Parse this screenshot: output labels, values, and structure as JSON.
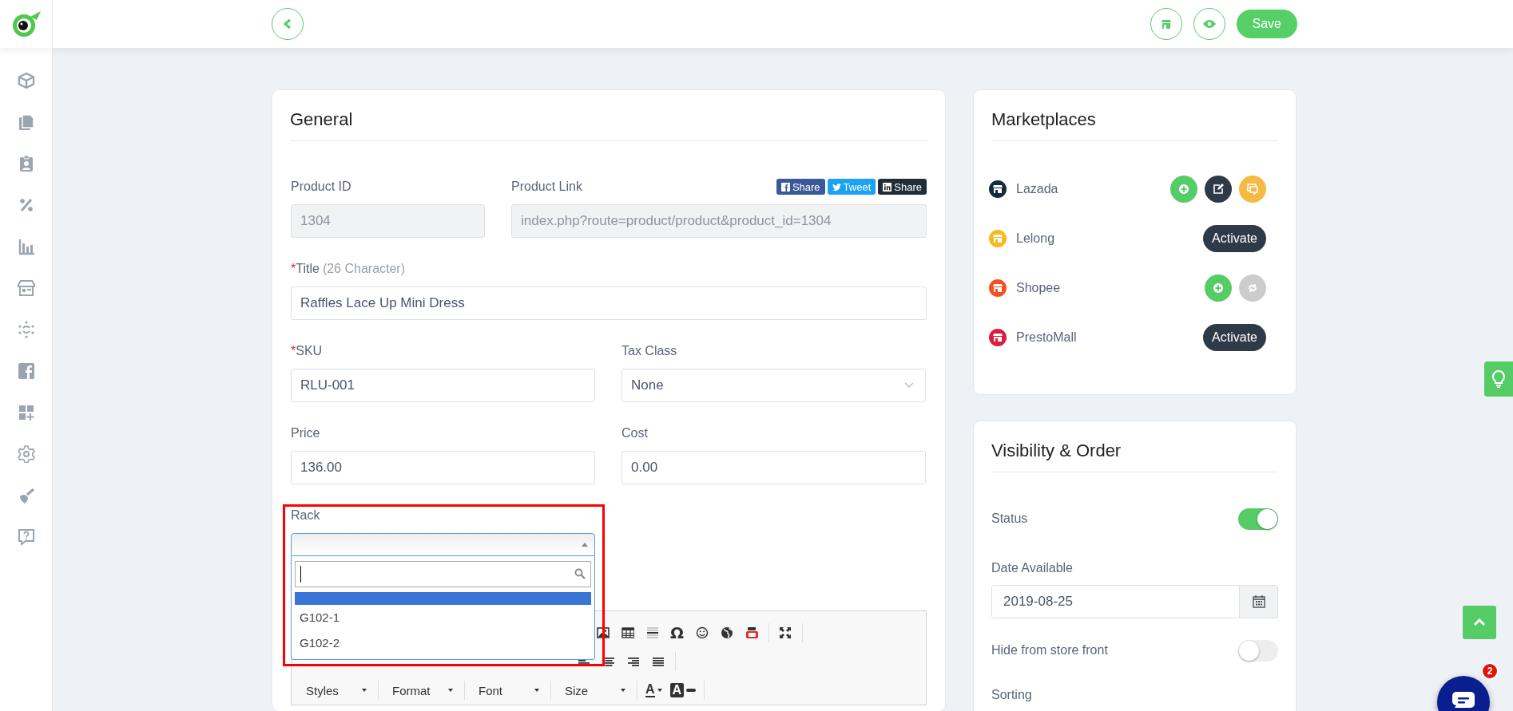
{
  "top_bar": {
    "save_button": "Save"
  },
  "general": {
    "title": "General",
    "product_id": {
      "label": "Product ID",
      "value": "1304",
      "disabled": true
    },
    "product_link": {
      "label": "Product Link",
      "value": "index.php?route=product/product&product_id=1304",
      "disabled": true
    },
    "share_buttons": [
      {
        "kind": "facebook",
        "label": "Share"
      },
      {
        "kind": "twitter",
        "label": "Tweet"
      },
      {
        "kind": "linkedin",
        "label": "Share"
      }
    ],
    "title_field": {
      "required_mark": "*",
      "label": "Title",
      "hint": "(26 Character)",
      "value": "Raffles Lace Up Mini Dress"
    },
    "sku": {
      "required_mark": "*",
      "label": "SKU",
      "value": "RLU-001"
    },
    "tax_class": {
      "label": "Tax Class",
      "value": "None"
    },
    "price": {
      "label": "Price",
      "value": "136.00"
    },
    "cost": {
      "label": "Cost",
      "value": "0.00"
    },
    "rack": {
      "label": "Rack",
      "highlighted": true,
      "expanded": true,
      "options": [
        {
          "kind": "blank",
          "selected": true
        },
        {
          "label": "G102-1",
          "selected": false
        },
        {
          "label": "G102-2",
          "selected": false
        }
      ]
    },
    "editor": {
      "symbol_button": "Ω",
      "dropdowns": [
        "Styles",
        "Format",
        "Font",
        "Size"
      ],
      "color_buttons": [
        {
          "kind": "text",
          "label": "A"
        },
        {
          "kind": "background",
          "label": "A"
        }
      ]
    }
  },
  "marketplaces": {
    "title": "Marketplaces",
    "items": [
      {
        "name": "Lazada",
        "color": "#142a3e",
        "activated": true,
        "actions": [
          {
            "kind": "add",
            "disabled": false
          },
          {
            "kind": "edit",
            "disabled": false
          },
          {
            "kind": "messages",
            "disabled": false
          }
        ]
      },
      {
        "name": "Lelong",
        "color": "#f9b81b",
        "activated": false,
        "activate_button": "Activate"
      },
      {
        "name": "Shopee",
        "color": "#f4511e",
        "activated": true,
        "actions": [
          {
            "kind": "add",
            "disabled": false
          },
          {
            "kind": "sync",
            "disabled": true
          }
        ]
      },
      {
        "name": "PrestoMall",
        "color": "#dc1c3a",
        "activated": false,
        "activate_button": "Activate"
      }
    ]
  },
  "visibility": {
    "title": "Visibility & Order",
    "status": {
      "label": "Status",
      "on": true
    },
    "date_available": {
      "label": "Date Available",
      "value": "2019-08-25"
    },
    "hide_from_store_front": {
      "label": "Hide from store front",
      "on": false
    },
    "sorting": {
      "label": "Sorting"
    }
  },
  "chat": {
    "badge": "2"
  }
}
